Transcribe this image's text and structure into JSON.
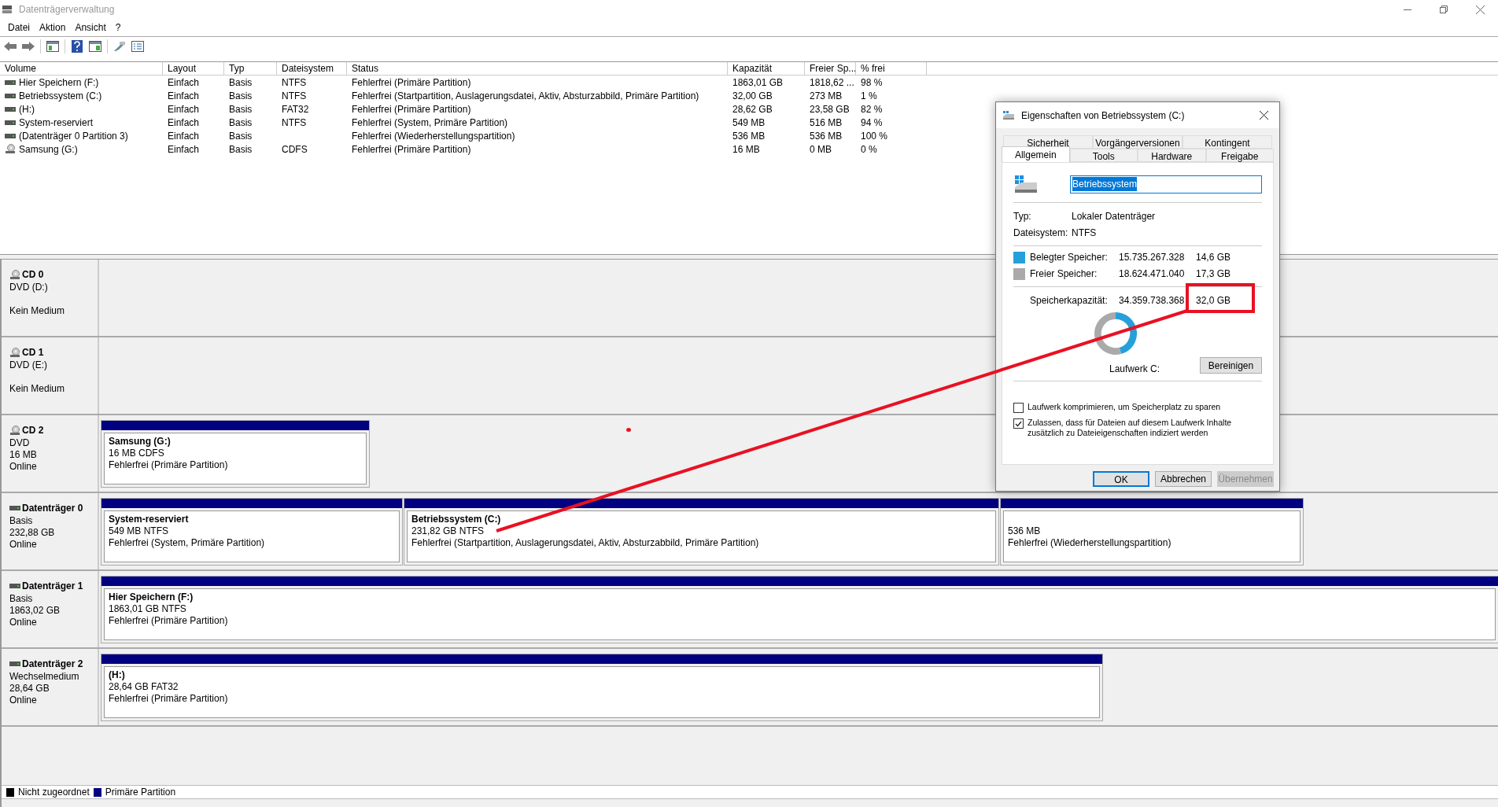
{
  "window": {
    "title": "Datenträgerverwaltung"
  },
  "menu": [
    "Datei",
    "Aktion",
    "Ansicht",
    "?"
  ],
  "volume_table": {
    "columns": [
      "Volume",
      "Layout",
      "Typ",
      "Dateisystem",
      "Status",
      "Kapazität",
      "Freier Sp...",
      "% frei"
    ],
    "rows": [
      {
        "kind": "disk",
        "cells": [
          "Hier Speichern (F:)",
          "Einfach",
          "Basis",
          "NTFS",
          "Fehlerfrei (Primäre Partition)",
          "1863,01 GB",
          "1818,62 ...",
          "98 %"
        ]
      },
      {
        "kind": "disk",
        "cells": [
          "Betriebssystem (C:)",
          "Einfach",
          "Basis",
          "NTFS",
          "Fehlerfrei (Startpartition, Auslagerungsdatei, Aktiv, Absturzabbild, Primäre Partition)",
          "32,00 GB",
          "273 MB",
          "1 %"
        ]
      },
      {
        "kind": "disk",
        "cells": [
          "(H:)",
          "Einfach",
          "Basis",
          "FAT32",
          "Fehlerfrei (Primäre Partition)",
          "28,62 GB",
          "23,58 GB",
          "82 %"
        ]
      },
      {
        "kind": "disk",
        "cells": [
          "System-reserviert",
          "Einfach",
          "Basis",
          "NTFS",
          "Fehlerfrei (System, Primäre Partition)",
          "549 MB",
          "516 MB",
          "94 %"
        ]
      },
      {
        "kind": "disk",
        "cells": [
          "(Datenträger 0 Partition 3)",
          "Einfach",
          "Basis",
          "",
          "Fehlerfrei (Wiederherstellungspartition)",
          "536 MB",
          "536 MB",
          "100 %"
        ]
      },
      {
        "kind": "cd",
        "cells": [
          "Samsung (G:)",
          "Einfach",
          "Basis",
          "CDFS",
          "Fehlerfrei (Primäre Partition)",
          "16 MB",
          "0 MB",
          "0 %"
        ]
      }
    ]
  },
  "disks": [
    {
      "kind": "cd",
      "name": "CD 0",
      "lines": [
        "DVD (D:)"
      ],
      "media_status": "Kein Medium"
    },
    {
      "kind": "cd",
      "name": "CD 1",
      "lines": [
        "DVD (E:)"
      ],
      "media_status": "Kein Medium"
    },
    {
      "kind": "cd",
      "name": "CD 2",
      "lines": [
        "DVD",
        "16 MB",
        "Online"
      ],
      "partitions": [
        {
          "name": "Samsung  (G:)",
          "size": "16 MB CDFS",
          "status": "Fehlerfrei (Primäre Partition)"
        }
      ]
    },
    {
      "kind": "disk",
      "name": "Datenträger 0",
      "lines": [
        "Basis",
        "232,88 GB",
        "Online"
      ],
      "partitions": [
        {
          "name": "System-reserviert",
          "size": "549 MB NTFS",
          "status": "Fehlerfrei (System, Primäre Partition)"
        },
        {
          "name": "Betriebssystem  (C:)",
          "size": "231,82 GB NTFS",
          "status": "Fehlerfrei (Startpartition, Auslagerungsdatei, Aktiv, Absturzabbild, Primäre Partition)"
        },
        {
          "size": "536 MB",
          "status": "Fehlerfrei (Wiederherstellungspartition)"
        }
      ]
    },
    {
      "kind": "disk",
      "name": "Datenträger 1",
      "lines": [
        "Basis",
        "1863,02 GB",
        "Online"
      ],
      "partitions": [
        {
          "name": "Hier Speichern  (F:)",
          "size": "1863,01 GB NTFS",
          "status": "Fehlerfrei (Primäre Partition)"
        }
      ]
    },
    {
      "kind": "disk",
      "name": "Datenträger 2",
      "lines": [
        "Wechselmedium",
        "28,64 GB",
        "Online"
      ],
      "partitions": [
        {
          "name": "(H:)",
          "size": "28,64 GB FAT32",
          "status": "Fehlerfrei (Primäre Partition)"
        }
      ]
    }
  ],
  "legend": [
    {
      "label": "Nicht zugeordnet",
      "color": "#000000"
    },
    {
      "label": "Primäre Partition",
      "color": "#000080"
    }
  ],
  "dialog": {
    "title": "Eigenschaften von Betriebssystem (C:)",
    "tab_rows": [
      [
        {
          "label": "Sicherheit",
          "selected": false
        },
        {
          "label": "Vorgängerversionen",
          "selected": false
        },
        {
          "label": "Kontingent",
          "selected": false
        }
      ],
      [
        {
          "label": "Allgemein",
          "selected": true
        },
        {
          "label": "Tools",
          "selected": false
        },
        {
          "label": "Hardware",
          "selected": false
        },
        {
          "label": "Freigabe",
          "selected": false
        }
      ]
    ],
    "name_value": "Betriebssystem",
    "info": [
      {
        "label": "Typ:",
        "value": "Lokaler Datenträger"
      },
      {
        "label": "Dateisystem:",
        "value": "NTFS"
      }
    ],
    "storage": [
      {
        "label": "Belegter Speicher:",
        "bytes": "15.735.267.328",
        "size": "14,6 GB",
        "color": "#26a0da"
      },
      {
        "label": "Freier Speicher:",
        "bytes": "18.624.471.040",
        "size": "17,3 GB",
        "color": "#aaaaaa"
      }
    ],
    "capacity": {
      "label": "Speicherkapazität:",
      "bytes": "34.359.738.368",
      "size": "32,0 GB"
    },
    "chart_data": {
      "type": "donut",
      "values": [
        45.8,
        54.2
      ]
    },
    "drive_label": "Laufwerk C:",
    "cleanup_button": "Bereinigen",
    "options": [
      {
        "label": "Laufwerk komprimieren, um Speicherplatz zu sparen",
        "checked": false
      },
      {
        "label": "Zulassen, dass für Dateien auf diesem Laufwerk Inhalte zusätzlich zu Dateieigenschaften indiziert werden",
        "checked": true
      }
    ],
    "buttons": [
      {
        "label": "OK",
        "kind": "default"
      },
      {
        "label": "Abbrechen",
        "kind": "normal"
      },
      {
        "label": "Übernehmen",
        "kind": "disabled"
      }
    ]
  }
}
